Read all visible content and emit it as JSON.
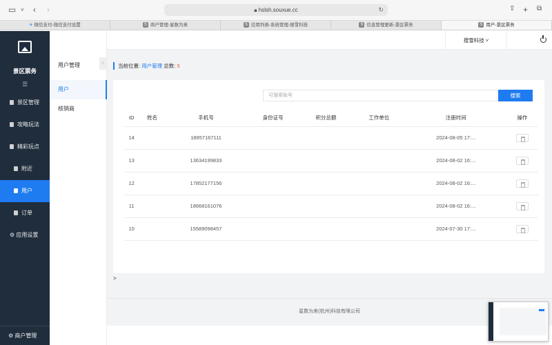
{
  "browser": {
    "url": "hslsh.souxue.cc",
    "tabs": [
      {
        "label": "微信支付-微信支付设置",
        "favicon": ""
      },
      {
        "label": "商户管理-星数为来",
        "favicon": "S"
      },
      {
        "label": "应用列表-系统管理-搜雪科技",
        "favicon": "S"
      },
      {
        "label": "信息管理更新-景区票务",
        "favicon": "S"
      },
      {
        "label": "用户-景区票务",
        "favicon": "S"
      }
    ]
  },
  "sidebar": {
    "brand": "景区票务",
    "toggle": "☰",
    "items": [
      {
        "label": "景区管理"
      },
      {
        "label": "攻略玩法"
      },
      {
        "label": "精彩玩点"
      },
      {
        "label": "附近"
      },
      {
        "label": "用户"
      },
      {
        "label": "订单"
      },
      {
        "label": "应用设置"
      }
    ],
    "bottom": "商户管理"
  },
  "subnav": {
    "title": "用户管理",
    "collapse": "‹",
    "items": [
      {
        "label": "用户"
      },
      {
        "label": "核销商"
      }
    ]
  },
  "topbar": {
    "company": "搜雪科技 ˅"
  },
  "breadcrumb": {
    "prefix": "当前位置:",
    "current": "用户管理",
    "total_label": "总数:",
    "total": "5"
  },
  "search": {
    "placeholder": "可搜索账号",
    "button": "搜索"
  },
  "table": {
    "headers": [
      "ID",
      "姓名",
      "手机号",
      "身份证号",
      "积分总额",
      "工作单位",
      "注册时间",
      "操作"
    ],
    "rows": [
      {
        "id": "14",
        "name": "",
        "phone": "18957167111",
        "idcard": "",
        "points": "",
        "work": "",
        "time": "2024-08-05 17:..."
      },
      {
        "id": "13",
        "name": "",
        "phone": "13634199833",
        "idcard": "",
        "points": "",
        "work": "",
        "time": "2024-08-02 16:..."
      },
      {
        "id": "12",
        "name": "",
        "phone": "17852177156",
        "idcard": "",
        "points": "",
        "work": "",
        "time": "2024-08-02 16:..."
      },
      {
        "id": "11",
        "name": "",
        "phone": "18668161076",
        "idcard": "",
        "points": "",
        "work": "",
        "time": "2024-08-02 16:..."
      },
      {
        "id": "10",
        "name": "",
        "phone": "15589098457",
        "idcard": "",
        "points": "",
        "work": "",
        "time": "2024-07-30 17:..."
      }
    ]
  },
  "misc": {
    "arrow": ">"
  },
  "footer": {
    "text": "星数为来(杭州)科技有限公司"
  },
  "colors": {
    "accent": "#1e7bf0",
    "sidebar_bg": "#1f2d3d",
    "count": "#e9573f"
  }
}
